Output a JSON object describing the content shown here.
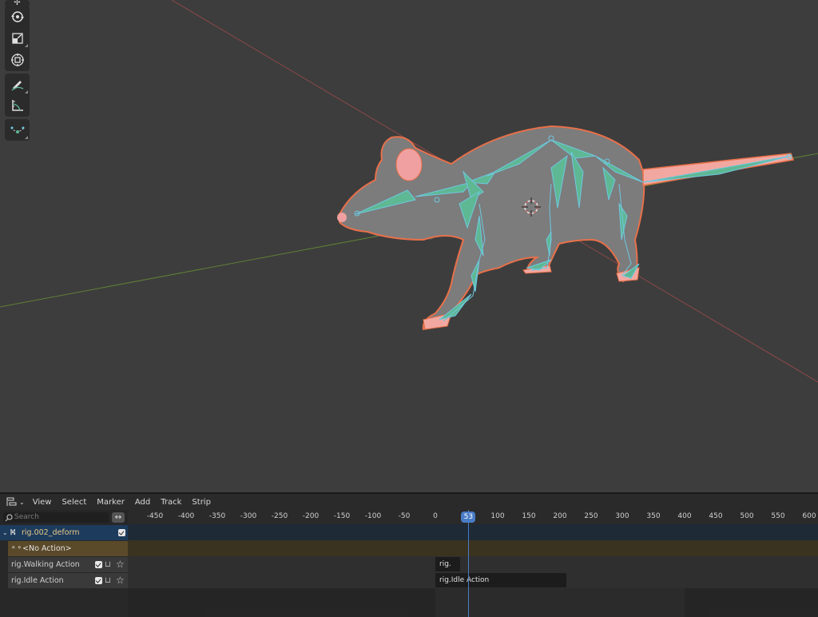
{
  "window": {
    "editors": [
      "3D Viewport",
      "Nonlinear Animation"
    ]
  },
  "viewport": {
    "tools": [
      {
        "name": "move-tool",
        "icon": "move-icon"
      },
      {
        "name": "rotate-tool",
        "icon": "rotate-icon"
      },
      {
        "name": "scale-tool",
        "icon": "scale-icon"
      },
      {
        "name": "transform-tool",
        "icon": "transform-icon"
      },
      {
        "name": "annotate-tool",
        "icon": "annotate-icon"
      },
      {
        "name": "measure-tool",
        "icon": "measure-icon"
      },
      {
        "name": "bone-size-tool",
        "icon": "bone-envelope-icon"
      }
    ],
    "scene_object": "rat mesh with armature (selected, orange outline)",
    "colors": {
      "background": "#3d3d3d",
      "x_axis": "#9a4a4a",
      "y_axis": "#6a8a3a",
      "body": "#7a7a7a",
      "outline": "#e8704a",
      "bones": "#5fb894",
      "bone_selected": "#6ec8e0",
      "ear_inner": "#f0a0a0",
      "tail": "#f2a8a0"
    }
  },
  "nla": {
    "header": {
      "editor_icon": "nla-editor-icon",
      "menus": [
        "View",
        "Select",
        "Marker",
        "Add",
        "Track",
        "Strip"
      ]
    },
    "search": {
      "placeholder": "Search",
      "sync_icon": "↔"
    },
    "current_frame": "53",
    "ruler_ticks": [
      "-450",
      "-400",
      "-350",
      "-300",
      "-250",
      "-200",
      "-150",
      "-100",
      "-50",
      "0",
      "50",
      "100",
      "150",
      "200",
      "250",
      "300",
      "350",
      "400",
      "450",
      "500",
      "550",
      "600"
    ],
    "channels": [
      {
        "label": "rig.002_deform",
        "type": "object",
        "checked": true
      },
      {
        "label": "<No Action>",
        "type": "action"
      },
      {
        "label": "rig.Walking Action",
        "type": "track",
        "checked": true
      },
      {
        "label": "rig.Idle Action",
        "type": "track",
        "checked": true
      }
    ],
    "strips": [
      {
        "label": "rig.",
        "track": "rig.Walking Action",
        "start": 0,
        "end": 40
      },
      {
        "label": "rig.Idle Action",
        "track": "rig.Idle Action",
        "start": 0,
        "end": 210
      }
    ],
    "scene_range": {
      "start": 0,
      "end": 400
    },
    "colors": {
      "object_row": "#1d3b5c",
      "object_text": "#e8c98a",
      "action_row": "#5a4a2a",
      "track_row": "#3a3a3a",
      "playhead": "#4a7cc7"
    }
  }
}
